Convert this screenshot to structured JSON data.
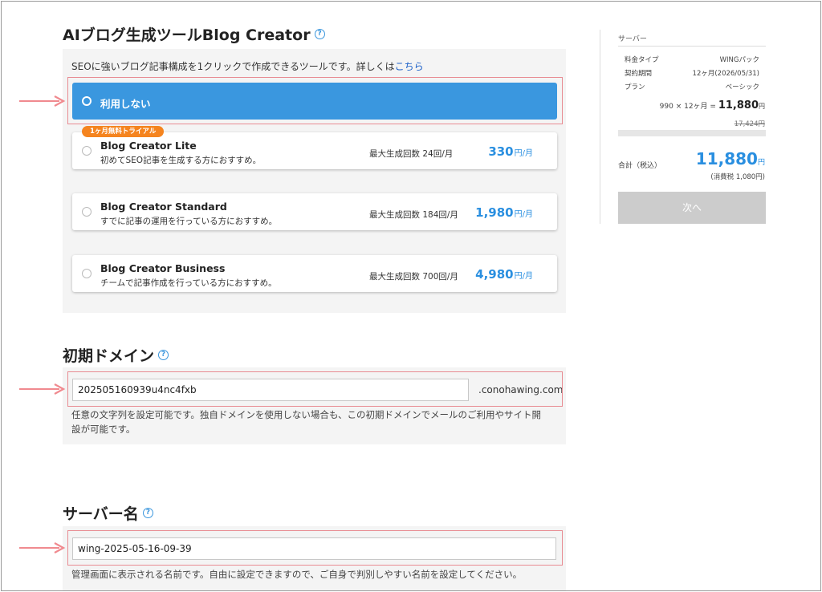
{
  "blog_creator": {
    "title": "AIブログ生成ツールBlog Creator",
    "help": "?",
    "description": "SEOに強いブログ記事構成を1クリックで作成できるツールです。詳しくは",
    "description_link": "こちら",
    "trial_badge": "1ヶ月無料トライアル",
    "options": [
      {
        "name": "利用しない",
        "selected": true
      },
      {
        "name": "Blog Creator Lite",
        "sub": "初めてSEO記事を生成する方におすすめ。",
        "count": "最大生成回数 24回/月",
        "price": "330",
        "unit": "円/月"
      },
      {
        "name": "Blog Creator Standard",
        "sub": "すでに記事の運用を行っている方におすすめ。",
        "count": "最大生成回数 184回/月",
        "price": "1,980",
        "unit": "円/月"
      },
      {
        "name": "Blog Creator Business",
        "sub": "チームで記事作成を行っている方におすすめ。",
        "count": "最大生成回数 700回/月",
        "price": "4,980",
        "unit": "円/月"
      }
    ]
  },
  "domain": {
    "title": "初期ドメイン",
    "help": "?",
    "value": "202505160939u4nc4fxb",
    "suffix": ".conohawing.com",
    "note_line1": "任意の文字列を設定可能です。独自ドメインを使用しない場合も、この初期ドメインでメールのご利用やサイト開",
    "note_line2": "設が可能です。"
  },
  "server_name": {
    "title": "サーバー名",
    "help": "?",
    "value": "wing-2025-05-16-09-39",
    "note": "管理画面に表示される名前です。自由に設定できますので、ご自身で判別しやすい名前を設定してください。"
  },
  "summary": {
    "section_label": "サーバー",
    "rows": [
      {
        "label": "料金タイプ",
        "value": "WINGパック"
      },
      {
        "label": "契約期間",
        "value": "12ヶ月(2026/05/31)"
      },
      {
        "label": "プラン",
        "value": "ベーシック"
      }
    ],
    "calc_prefix": "990 × 12ヶ月 =",
    "calc_total": "11,880",
    "calc_unit": "円",
    "strike_price": "17,424円",
    "total_label": "合計（税込）",
    "total_value": "11,880",
    "total_unit": "円",
    "tax_note": "(消費税 1,080円)",
    "next_button": "次へ"
  },
  "colors": {
    "accent": "#3a97df",
    "badge": "#f5841f",
    "highlight": "#e88b92",
    "arrow": "#f08a8f"
  }
}
